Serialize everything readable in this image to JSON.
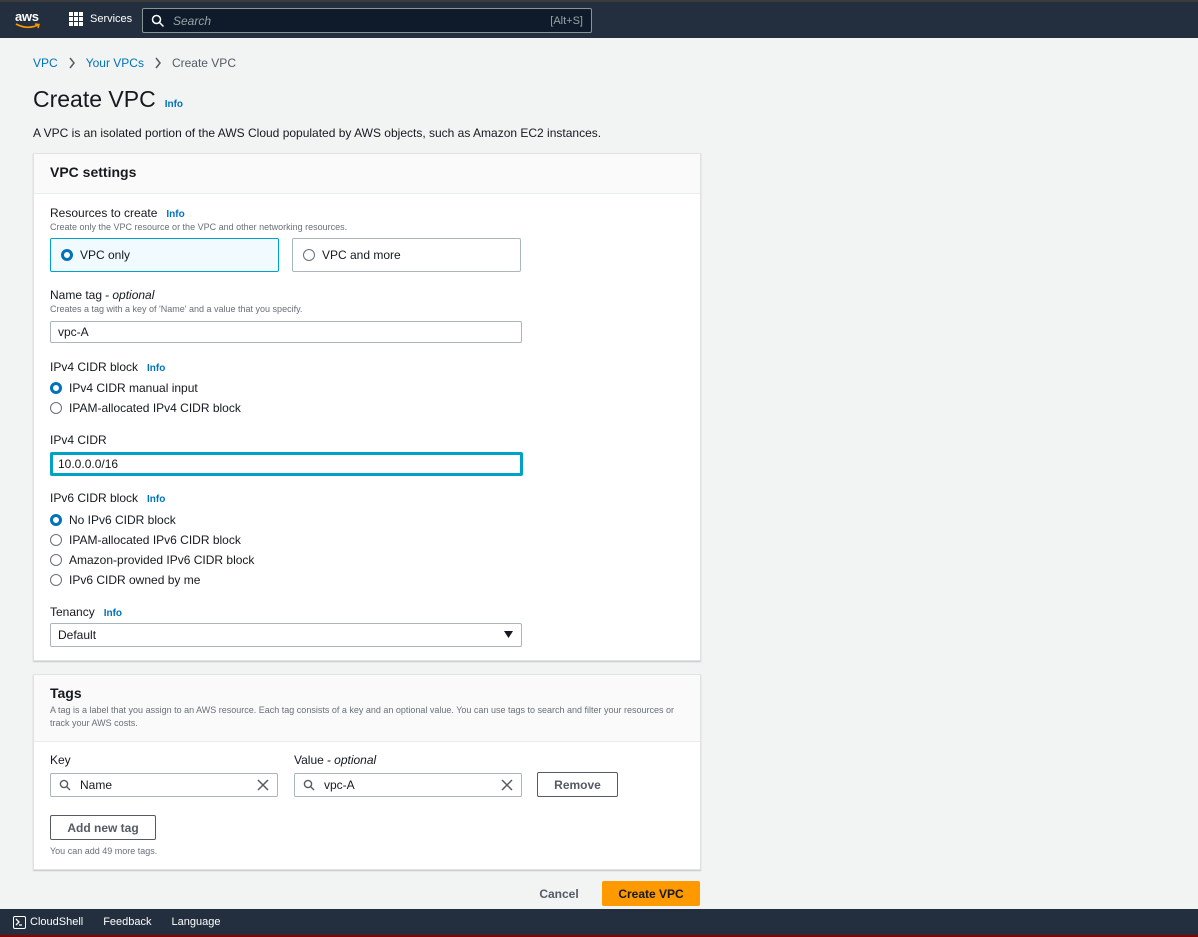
{
  "topnav": {
    "logo_text": "aws",
    "services_label": "Services",
    "search_placeholder": "Search",
    "search_shortcut": "[Alt+S]"
  },
  "breadcrumb": {
    "items": [
      "VPC",
      "Your VPCs"
    ],
    "current": "Create VPC"
  },
  "page": {
    "title": "Create VPC",
    "info": "Info",
    "description": "A VPC is an isolated portion of the AWS Cloud populated by AWS objects, such as Amazon EC2 instances."
  },
  "vpc_settings": {
    "heading": "VPC settings",
    "resources": {
      "label": "Resources to create",
      "info": "Info",
      "hint": "Create only the VPC resource or the VPC and other networking resources.",
      "options": [
        "VPC only",
        "VPC and more"
      ],
      "selected": "VPC only"
    },
    "name_tag": {
      "label": "Name tag",
      "optional": "- optional",
      "hint": "Creates a tag with a key of 'Name' and a value that you specify.",
      "value": "vpc-A"
    },
    "ipv4_block": {
      "label": "IPv4 CIDR block",
      "info": "Info",
      "options": [
        "IPv4 CIDR manual input",
        "IPAM-allocated IPv4 CIDR block"
      ],
      "selected": "IPv4 CIDR manual input"
    },
    "ipv4_cidr": {
      "label": "IPv4 CIDR",
      "value": "10.0.0.0/16"
    },
    "ipv6_block": {
      "label": "IPv6 CIDR block",
      "info": "Info",
      "options": [
        "No IPv6 CIDR block",
        "IPAM-allocated IPv6 CIDR block",
        "Amazon-provided IPv6 CIDR block",
        "IPv6 CIDR owned by me"
      ],
      "selected": "No IPv6 CIDR block"
    },
    "tenancy": {
      "label": "Tenancy",
      "info": "Info",
      "value": "Default"
    }
  },
  "tags": {
    "heading": "Tags",
    "hint": "A tag is a label that you assign to an AWS resource. Each tag consists of a key and an optional value. You can use tags to search and filter your resources or track your AWS costs.",
    "key_label": "Key",
    "value_label": "Value",
    "value_optional": "- optional",
    "rows": [
      {
        "key": "Name",
        "value": "vpc-A"
      }
    ],
    "remove_label": "Remove",
    "add_label": "Add new tag",
    "remaining": "You can add 49 more tags."
  },
  "actions": {
    "cancel": "Cancel",
    "create": "Create VPC"
  },
  "bottombar": {
    "cloudshell": "CloudShell",
    "feedback": "Feedback",
    "language": "Language"
  },
  "colors": {
    "nav_bg": "#232f3e",
    "link": "#0073bb",
    "primary": "#ff9900",
    "selected_tile_bg": "#f1faff",
    "focus_border": "#00a1c9"
  }
}
